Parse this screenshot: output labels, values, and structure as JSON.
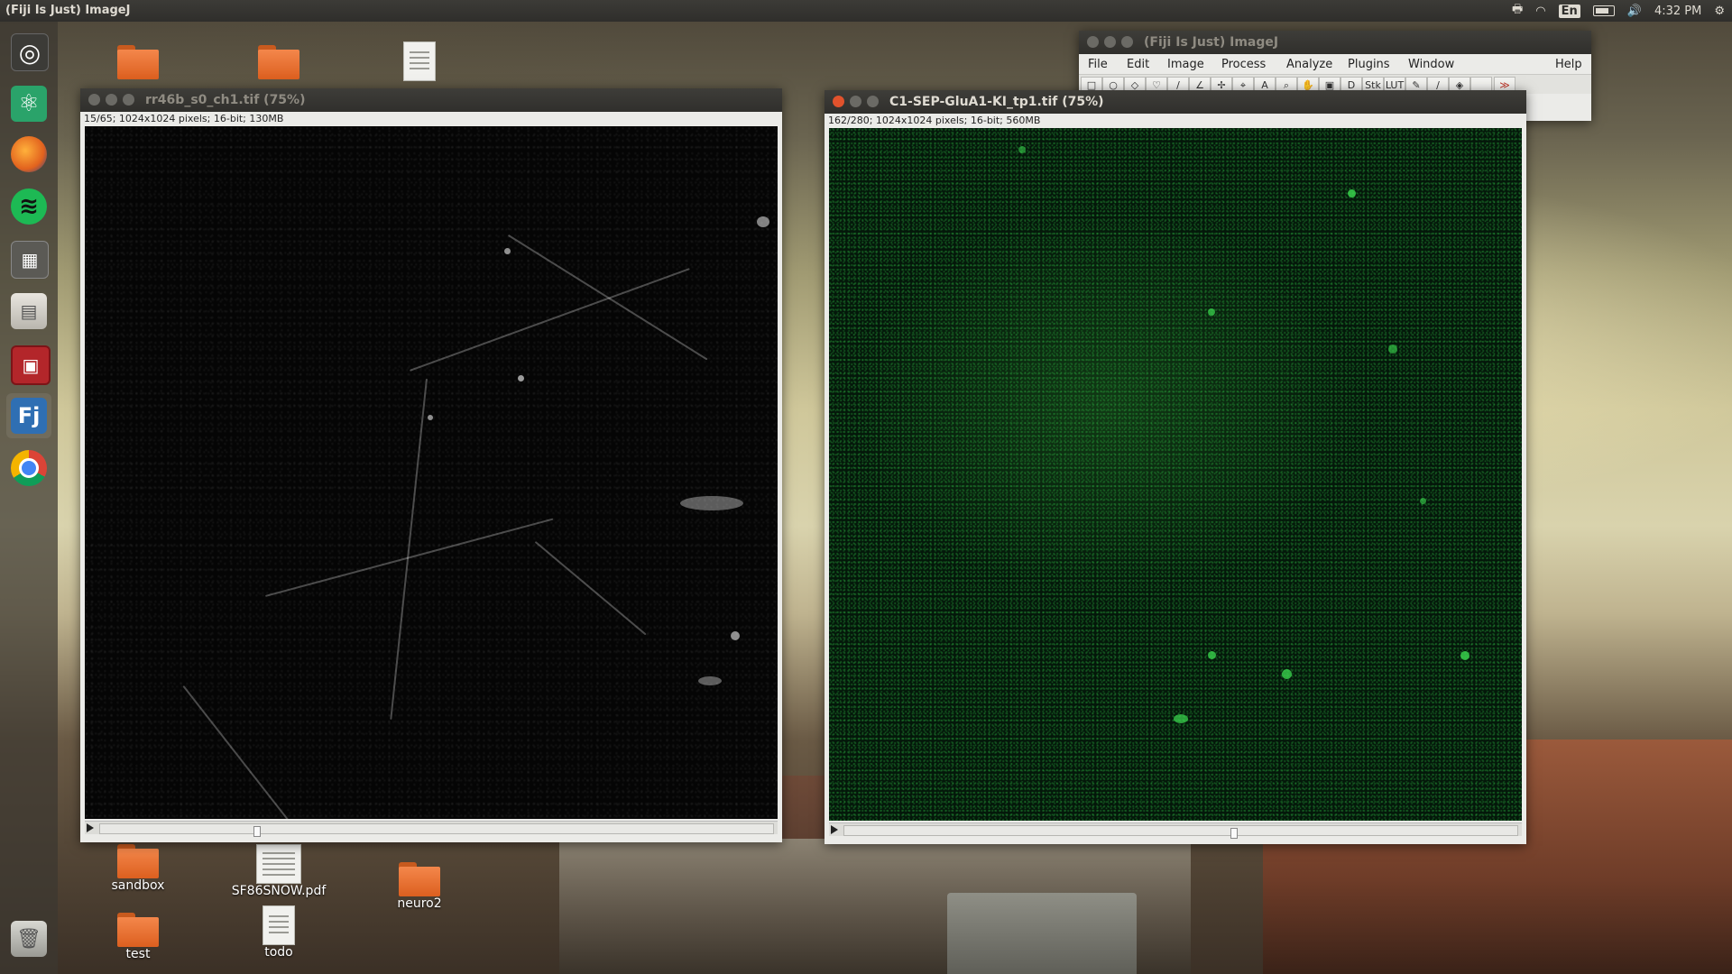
{
  "top_panel": {
    "app_title": "(Fiji Is Just) ImageJ",
    "keyboard_layout": "En",
    "clock": "4:32 PM"
  },
  "launcher": {
    "items": [
      {
        "name": "dash-home",
        "icon": "ubuntu-logo-icon"
      },
      {
        "name": "atom-editor",
        "icon": "atom-icon"
      },
      {
        "name": "firefox",
        "icon": "firefox-icon"
      },
      {
        "name": "spotify",
        "icon": "spotify-icon"
      },
      {
        "name": "workspace-switcher",
        "icon": "workspaces-icon"
      },
      {
        "name": "file-manager",
        "icon": "files-icon"
      },
      {
        "name": "system-monitor",
        "icon": "monitor-icon"
      },
      {
        "name": "fiji",
        "icon": "fiji-icon"
      },
      {
        "name": "chrome",
        "icon": "chrome-icon"
      },
      {
        "name": "trash",
        "icon": "trash-icon"
      }
    ]
  },
  "desktop_icons": [
    {
      "label": "",
      "type": "folder"
    },
    {
      "label": "",
      "type": "folder"
    },
    {
      "label": "",
      "type": "document"
    },
    {
      "label": "sandbox",
      "type": "folder"
    },
    {
      "label": "SF86SNOW.pdf",
      "type": "pdf"
    },
    {
      "label": "neuro2",
      "type": "folder"
    },
    {
      "label": "test",
      "type": "folder"
    },
    {
      "label": "todo",
      "type": "document"
    }
  ],
  "window_left": {
    "title": "rr46b_s0_ch1.tif (75%)",
    "info": "15/65; 1024x1024 pixels; 16-bit; 130MB",
    "slice_position": 0.23
  },
  "window_right": {
    "title": "C1-SEP-GluA1-KI_tp1.tif (75%)",
    "info": "162/280; 1024x1024 pixels; 16-bit; 560MB",
    "slice_position": 0.58
  },
  "fiji_main": {
    "title": "(Fiji Is Just) ImageJ",
    "menu": [
      "File",
      "Edit",
      "Image",
      "Process",
      "Analyze",
      "Plugins",
      "Window",
      "Help"
    ],
    "tools": [
      "□",
      "○",
      "◇",
      "♡",
      "/",
      "∠",
      "✢",
      "⌖",
      "A",
      "⌕",
      "✋",
      "▣",
      "D",
      "Stk",
      "LUT",
      "✎",
      "∕",
      "◈",
      "",
      "≫"
    ]
  }
}
